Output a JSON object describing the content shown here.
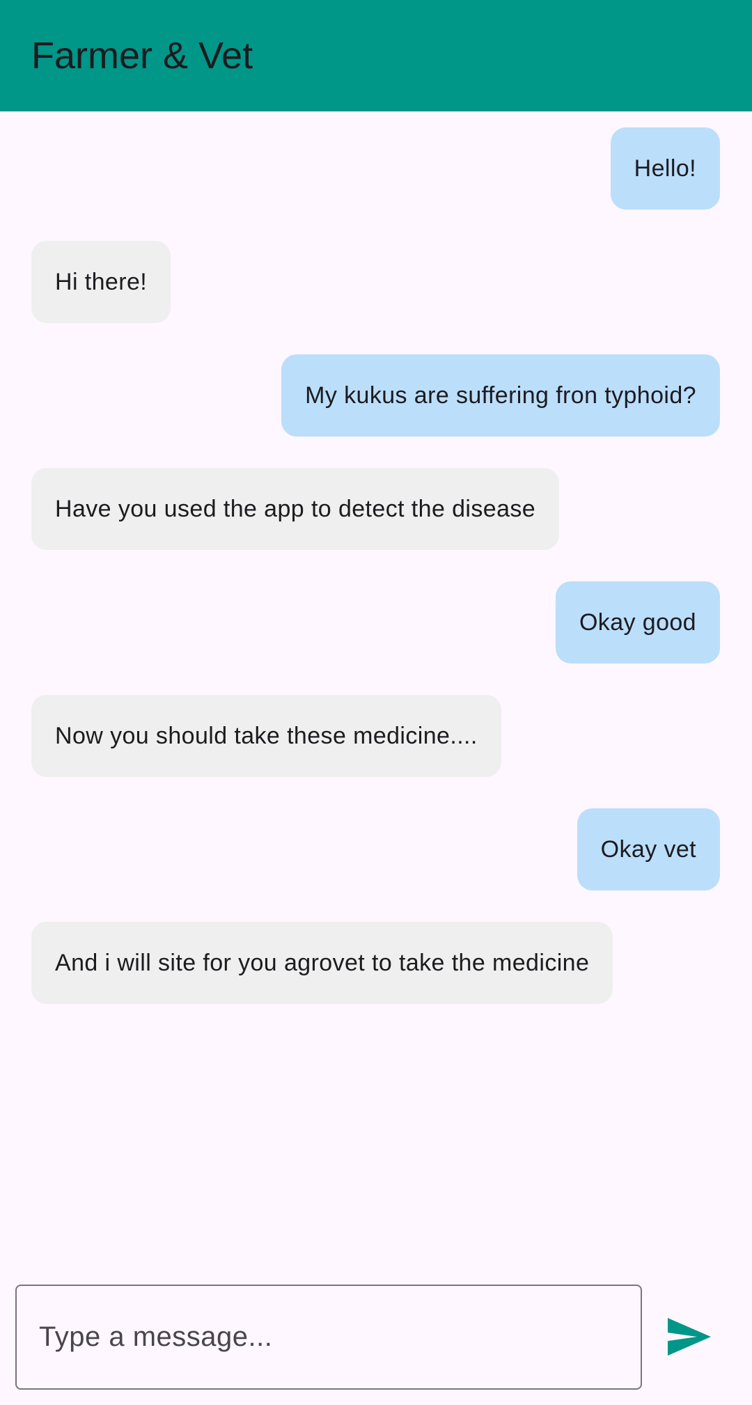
{
  "app_bar": {
    "title": "Farmer & Vet",
    "background_color": "#009688"
  },
  "messages": [
    {
      "sender": "farmer",
      "text": "Hello!"
    },
    {
      "sender": "vet",
      "text": "Hi there!"
    },
    {
      "sender": "farmer",
      "text": "My kukus are suffering fron typhoid?"
    },
    {
      "sender": "vet",
      "text": "Have you used the app to detect the disease"
    },
    {
      "sender": "farmer",
      "text": "Okay good"
    },
    {
      "sender": "vet",
      "text": "Now you should take these medicine...."
    },
    {
      "sender": "farmer",
      "text": "Okay vet"
    },
    {
      "sender": "vet",
      "text": "And i will site for you agrovet to take the medicine"
    }
  ],
  "composer": {
    "value": "",
    "placeholder": "Type a message...",
    "send_icon": "send-icon"
  },
  "colors": {
    "sent_bubble": "#BBDEFB",
    "received_bubble": "#EEEFEE",
    "send_icon": "#009688",
    "background": "#FEF7FF"
  }
}
